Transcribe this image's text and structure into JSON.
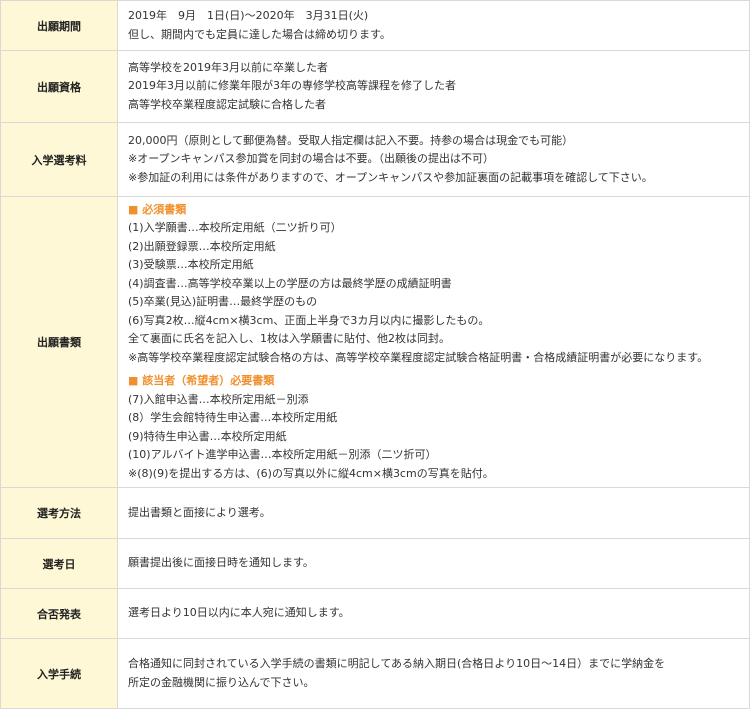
{
  "rows": [
    {
      "label": "出願期間",
      "lines": [
        "2019年　9月　1日(日)～2020年　3月31日(火)",
        "但し、期間内でも定員に達した場合は締め切ります。"
      ]
    },
    {
      "label": "出願資格",
      "lines": [
        "高等学校を2019年3月以前に卒業した者",
        "2019年3月以前に修業年限が3年の専修学校高等課程を修了した者",
        "高等学校卒業程度認定試験に合格した者"
      ]
    },
    {
      "label": "入学選考料",
      "lines": [
        "20,000円（原則として郵便為替。受取人指定欄は記入不要。持参の場合は現金でも可能）",
        "※オープンキャンパス参加賞を同封の場合は不要。（出願後の提出は不可）",
        "※参加証の利用には条件がありますので、オープンキャンパスや参加証裏面の記載事項を確認して下さい。"
      ]
    },
    {
      "label": "出願書類",
      "required_heading": "■ 必須書類",
      "required_items": [
        "(1)入学願書…本校所定用紙（二ツ折り可）",
        "(2)出願登録票…本校所定用紙",
        "(3)受験票…本校所定用紙",
        "(4)調査書…高等学校卒業以上の学歴の方は最終学歴の成績証明書",
        "(5)卒業(見込)証明書…最終学歴のもの",
        "(6)写真2枚…縦4cm×横3cm、正面上半身で3カ月以内に撮影したもの。",
        "全て裏面に氏名を記入し、1枚は入学願書に貼付、他2枚は同封。",
        "※高等学校卒業程度認定試験合格の方は、高等学校卒業程度認定試験合格証明書・合格成績証明書が必要になります。"
      ],
      "optional_heading": "■ 該当者（希望者）必要書類",
      "optional_items": [
        "(7)入館申込書…本校所定用紙－別添",
        "(8）学生会館特待生申込書…本校所定用紙",
        "(9)特待生申込書…本校所定用紙",
        "(10)アルバイト進学申込書…本校所定用紙－別添（二ツ折可）",
        "※(8)(9)を提出する方は、(6)の写真以外に縦4cm×横3cmの写真を貼付。"
      ]
    },
    {
      "label": "選考方法",
      "lines": [
        "提出書類と面接により選考。"
      ]
    },
    {
      "label": "選考日",
      "lines": [
        "願書提出後に面接日時を通知します。"
      ]
    },
    {
      "label": "合否発表",
      "lines": [
        "選考日より10日以内に本人宛に通知します。"
      ]
    },
    {
      "label": "入学手続",
      "lines": [
        "合格通知に同封されている入学手続の書類に明記してある納入期日(合格日より10日～14日）までに学納金を",
        "所定の金融機関に振り込んで下さい。"
      ]
    }
  ]
}
